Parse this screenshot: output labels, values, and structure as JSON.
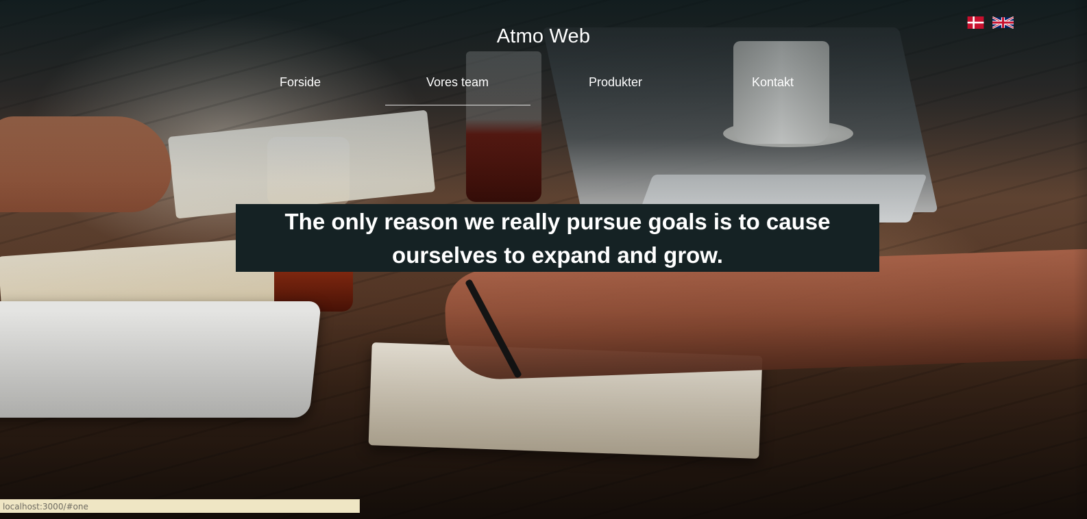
{
  "site": {
    "title": "Atmo Web"
  },
  "nav": {
    "items": [
      {
        "label": "Forside"
      },
      {
        "label": "Vores team"
      },
      {
        "label": "Produkter"
      },
      {
        "label": "Kontakt"
      }
    ],
    "active_index": 1
  },
  "languages": [
    {
      "code": "da",
      "icon": "danish-flag-icon"
    },
    {
      "code": "en",
      "icon": "uk-flag-icon"
    }
  ],
  "hero": {
    "quote": "The only reason we really pursue goals is to cause ourselves to expand and grow.",
    "background": "photo of people working at a wooden table with laptops, notebooks and drinks"
  },
  "status_bar": {
    "url": "localhost:3000/#one"
  },
  "colors": {
    "quote_box_bg": "#152224",
    "text": "#ffffff",
    "status_bar_bg": "#efe6c4",
    "dk_red": "#c8102e",
    "uk_blue": "#012169"
  }
}
